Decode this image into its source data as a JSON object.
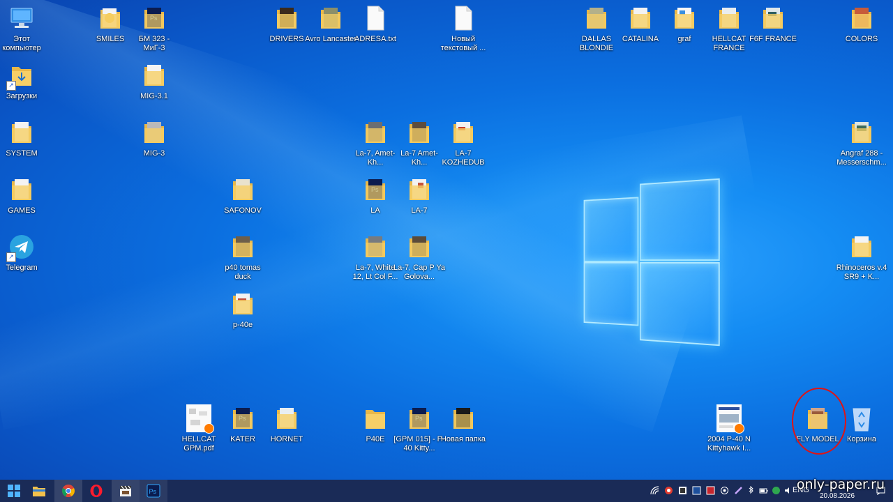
{
  "desktop": {
    "icons": {
      "computer": "Этот компьютер",
      "smiles": "SMILES",
      "bm323": "БМ 323 - МиГ-3",
      "drivers": "DRIVERS",
      "avro": "Avro Lancaster",
      "adresa": "ADRESA.txt",
      "newtext": "Новый текстовый ...",
      "dallas": "DALLAS BLONDIE",
      "catalina": "CATALINA",
      "graf": "graf",
      "hellcat_france": "HELLCAT FRANCE",
      "f6f": "F6F FRANCE",
      "colors": "COLORS",
      "downloads": "Загрузки",
      "mig31": "MIG-3.1",
      "system": "SYSTEM",
      "mig3": "MIG-3",
      "la7_amet1": "La-7, Amet-Kh...",
      "la7_amet2": "La-7 Amet-Kh...",
      "la7_kozh": "LA-7 KOZHEDUB",
      "angraf": "Angraf 288 - Messerschm...",
      "games": "GAMES",
      "safonov": "SAFONOV",
      "la": "LA",
      "la7": "LA-7",
      "telegram": "Telegram",
      "p40tomas": "p40 tomas duck",
      "la7_white": "La-7, White 12, Lt Col F...",
      "la7_cap": "La-7, Cap P Ya Golova...",
      "rhino": "Rhinoceros v.4 SR9 + K...",
      "p40e_lower": "p-40e",
      "hellcat_pdf": "HELLCAT GPM.pdf",
      "kater": "KATER",
      "hornet": "HORNET",
      "p40e": "P40E",
      "gpm015": "[GPM 015] - P-40 Kitty...",
      "newfolder": "Новая папка",
      "p40n": "2004 P-40 N Kittyhawk I...",
      "flymodel": "FLY MODEL",
      "recycle": "Корзина"
    }
  },
  "taskbar": {
    "lang": "ENG",
    "time": "",
    "date": "20.08.2026"
  },
  "watermark": "only-paper.ru",
  "colors": {
    "accent": "#0a6fe0",
    "taskbar": "#1a2b57",
    "highlight": "#e01414"
  }
}
